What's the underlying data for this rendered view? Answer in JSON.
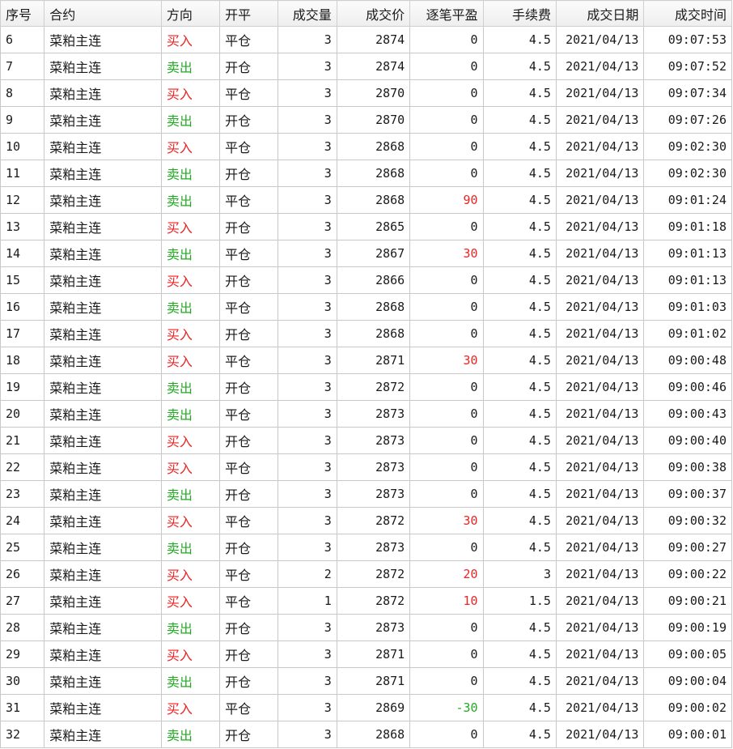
{
  "colors": {
    "buy": "#ee2222",
    "sell": "#22aa22",
    "profit_positive": "#ee2222",
    "profit_negative": "#22aa22",
    "grid": "#c8c8c8"
  },
  "table": {
    "headers": {
      "seq": "序号",
      "contract": "合约",
      "direction": "方向",
      "offset": "开平",
      "volume": "成交量",
      "price": "成交价",
      "pnl": "逐笔平盈",
      "fee": "手续费",
      "date": "成交日期",
      "time": "成交时间"
    },
    "rows": [
      {
        "seq": "6",
        "contract": "菜粕主连",
        "direction": "买入",
        "offset": "平仓",
        "volume": "3",
        "price": "2874",
        "pnl": "0",
        "fee": "4.5",
        "date": "2021/04/13",
        "time": "09:07:53"
      },
      {
        "seq": "7",
        "contract": "菜粕主连",
        "direction": "卖出",
        "offset": "开仓",
        "volume": "3",
        "price": "2874",
        "pnl": "0",
        "fee": "4.5",
        "date": "2021/04/13",
        "time": "09:07:52"
      },
      {
        "seq": "8",
        "contract": "菜粕主连",
        "direction": "买入",
        "offset": "平仓",
        "volume": "3",
        "price": "2870",
        "pnl": "0",
        "fee": "4.5",
        "date": "2021/04/13",
        "time": "09:07:34"
      },
      {
        "seq": "9",
        "contract": "菜粕主连",
        "direction": "卖出",
        "offset": "开仓",
        "volume": "3",
        "price": "2870",
        "pnl": "0",
        "fee": "4.5",
        "date": "2021/04/13",
        "time": "09:07:26"
      },
      {
        "seq": "10",
        "contract": "菜粕主连",
        "direction": "买入",
        "offset": "平仓",
        "volume": "3",
        "price": "2868",
        "pnl": "0",
        "fee": "4.5",
        "date": "2021/04/13",
        "time": "09:02:30"
      },
      {
        "seq": "11",
        "contract": "菜粕主连",
        "direction": "卖出",
        "offset": "开仓",
        "volume": "3",
        "price": "2868",
        "pnl": "0",
        "fee": "4.5",
        "date": "2021/04/13",
        "time": "09:02:30"
      },
      {
        "seq": "12",
        "contract": "菜粕主连",
        "direction": "卖出",
        "offset": "平仓",
        "volume": "3",
        "price": "2868",
        "pnl": "90",
        "fee": "4.5",
        "date": "2021/04/13",
        "time": "09:01:24"
      },
      {
        "seq": "13",
        "contract": "菜粕主连",
        "direction": "买入",
        "offset": "开仓",
        "volume": "3",
        "price": "2865",
        "pnl": "0",
        "fee": "4.5",
        "date": "2021/04/13",
        "time": "09:01:18"
      },
      {
        "seq": "14",
        "contract": "菜粕主连",
        "direction": "卖出",
        "offset": "平仓",
        "volume": "3",
        "price": "2867",
        "pnl": "30",
        "fee": "4.5",
        "date": "2021/04/13",
        "time": "09:01:13"
      },
      {
        "seq": "15",
        "contract": "菜粕主连",
        "direction": "买入",
        "offset": "开仓",
        "volume": "3",
        "price": "2866",
        "pnl": "0",
        "fee": "4.5",
        "date": "2021/04/13",
        "time": "09:01:13"
      },
      {
        "seq": "16",
        "contract": "菜粕主连",
        "direction": "卖出",
        "offset": "平仓",
        "volume": "3",
        "price": "2868",
        "pnl": "0",
        "fee": "4.5",
        "date": "2021/04/13",
        "time": "09:01:03"
      },
      {
        "seq": "17",
        "contract": "菜粕主连",
        "direction": "买入",
        "offset": "开仓",
        "volume": "3",
        "price": "2868",
        "pnl": "0",
        "fee": "4.5",
        "date": "2021/04/13",
        "time": "09:01:02"
      },
      {
        "seq": "18",
        "contract": "菜粕主连",
        "direction": "买入",
        "offset": "平仓",
        "volume": "3",
        "price": "2871",
        "pnl": "30",
        "fee": "4.5",
        "date": "2021/04/13",
        "time": "09:00:48"
      },
      {
        "seq": "19",
        "contract": "菜粕主连",
        "direction": "卖出",
        "offset": "开仓",
        "volume": "3",
        "price": "2872",
        "pnl": "0",
        "fee": "4.5",
        "date": "2021/04/13",
        "time": "09:00:46"
      },
      {
        "seq": "20",
        "contract": "菜粕主连",
        "direction": "卖出",
        "offset": "平仓",
        "volume": "3",
        "price": "2873",
        "pnl": "0",
        "fee": "4.5",
        "date": "2021/04/13",
        "time": "09:00:43"
      },
      {
        "seq": "21",
        "contract": "菜粕主连",
        "direction": "买入",
        "offset": "开仓",
        "volume": "3",
        "price": "2873",
        "pnl": "0",
        "fee": "4.5",
        "date": "2021/04/13",
        "time": "09:00:40"
      },
      {
        "seq": "22",
        "contract": "菜粕主连",
        "direction": "买入",
        "offset": "平仓",
        "volume": "3",
        "price": "2873",
        "pnl": "0",
        "fee": "4.5",
        "date": "2021/04/13",
        "time": "09:00:38"
      },
      {
        "seq": "23",
        "contract": "菜粕主连",
        "direction": "卖出",
        "offset": "开仓",
        "volume": "3",
        "price": "2873",
        "pnl": "0",
        "fee": "4.5",
        "date": "2021/04/13",
        "time": "09:00:37"
      },
      {
        "seq": "24",
        "contract": "菜粕主连",
        "direction": "买入",
        "offset": "平仓",
        "volume": "3",
        "price": "2872",
        "pnl": "30",
        "fee": "4.5",
        "date": "2021/04/13",
        "time": "09:00:32"
      },
      {
        "seq": "25",
        "contract": "菜粕主连",
        "direction": "卖出",
        "offset": "开仓",
        "volume": "3",
        "price": "2873",
        "pnl": "0",
        "fee": "4.5",
        "date": "2021/04/13",
        "time": "09:00:27"
      },
      {
        "seq": "26",
        "contract": "菜粕主连",
        "direction": "买入",
        "offset": "平仓",
        "volume": "2",
        "price": "2872",
        "pnl": "20",
        "fee": "3",
        "date": "2021/04/13",
        "time": "09:00:22"
      },
      {
        "seq": "27",
        "contract": "菜粕主连",
        "direction": "买入",
        "offset": "平仓",
        "volume": "1",
        "price": "2872",
        "pnl": "10",
        "fee": "1.5",
        "date": "2021/04/13",
        "time": "09:00:21"
      },
      {
        "seq": "28",
        "contract": "菜粕主连",
        "direction": "卖出",
        "offset": "开仓",
        "volume": "3",
        "price": "2873",
        "pnl": "0",
        "fee": "4.5",
        "date": "2021/04/13",
        "time": "09:00:19"
      },
      {
        "seq": "29",
        "contract": "菜粕主连",
        "direction": "买入",
        "offset": "开仓",
        "volume": "3",
        "price": "2871",
        "pnl": "0",
        "fee": "4.5",
        "date": "2021/04/13",
        "time": "09:00:05"
      },
      {
        "seq": "30",
        "contract": "菜粕主连",
        "direction": "卖出",
        "offset": "开仓",
        "volume": "3",
        "price": "2871",
        "pnl": "0",
        "fee": "4.5",
        "date": "2021/04/13",
        "time": "09:00:04"
      },
      {
        "seq": "31",
        "contract": "菜粕主连",
        "direction": "买入",
        "offset": "平仓",
        "volume": "3",
        "price": "2869",
        "pnl": "-30",
        "fee": "4.5",
        "date": "2021/04/13",
        "time": "09:00:02"
      },
      {
        "seq": "32",
        "contract": "菜粕主连",
        "direction": "卖出",
        "offset": "开仓",
        "volume": "3",
        "price": "2868",
        "pnl": "0",
        "fee": "4.5",
        "date": "2021/04/13",
        "time": "09:00:01"
      }
    ]
  }
}
